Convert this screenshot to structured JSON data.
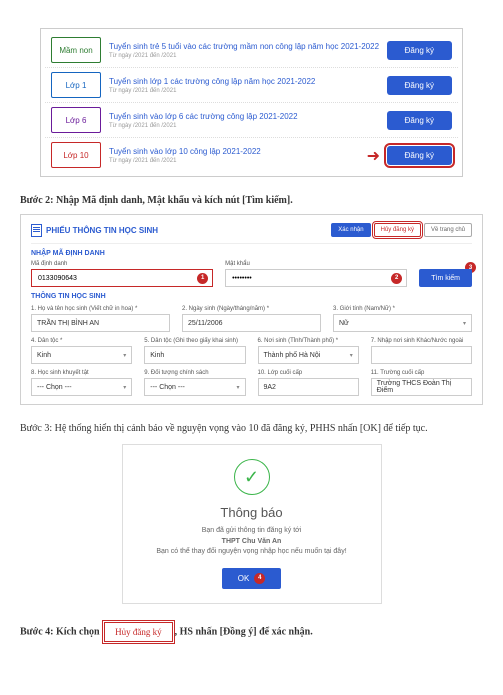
{
  "levels": [
    {
      "chip": "Mầm non",
      "title": "Tuyển sinh trẻ 5 tuổi vào các trường mầm non công lập năm học 2021-2022",
      "sub": "Từ ngày    /2021 đến    /2021",
      "btn": "Đăng ký"
    },
    {
      "chip": "Lớp 1",
      "title": "Tuyển sinh lớp 1 các trường công lập năm học 2021-2022",
      "sub": "Từ ngày    /2021 đến    /2021",
      "btn": "Đăng ký"
    },
    {
      "chip": "Lớp 6",
      "title": "Tuyển sinh vào lớp 6 các trường công lập 2021-2022",
      "sub": "Từ ngày    /2021 đến    /2021",
      "btn": "Đăng ký"
    },
    {
      "chip": "Lớp 10",
      "title": "Tuyển sinh vào lớp 10 công lập 2021-2022",
      "sub": "Từ ngày    /2021 đến    /2021",
      "btn": "Đăng ký"
    }
  ],
  "step2": "Bước 2: Nhập Mã định danh, Mật khẩu và kích nút [Tìm kiếm].",
  "form": {
    "title": "PHIẾU THÔNG TIN HỌC SINH",
    "btns": {
      "xn": "Xác nhận",
      "huy": "Hủy đăng ký",
      "ve": "Về trang chủ"
    },
    "sec1": "NHẬP MÃ ĐỊNH DANH",
    "f_id": "Mã định danh",
    "v_id": "0133090643",
    "f_pw": "Mật khẩu",
    "v_pw": "••••••••",
    "search": "Tìm kiếm",
    "sec2": "THÔNG TIN HỌC SINH",
    "f1": "1. Họ và tên học sinh (Viết chữ in hoa) *",
    "v1": "TRẦN THỊ BÌNH AN",
    "f2": "2. Ngày sinh (Ngày/tháng/năm) *",
    "v2": "25/11/2006",
    "f3": "3. Giới tính (Nam/Nữ) *",
    "v3": "Nữ",
    "f4": "4. Dân tộc *",
    "v4": "Kinh",
    "f5": "5. Dân tộc (Ghi theo giấy khai sinh)",
    "v5": "Kinh",
    "f6": "6. Nơi sinh (Tỉnh/Thành phố) *",
    "v6": "Thành phố Hà Nội",
    "f7": "7. Nhập nơi sinh Khác/Nước ngoài",
    "v7": "",
    "f8": "8. Học sinh khuyết tật",
    "v8": "--- Chọn ---",
    "f9": "9. Đối tượng chính sách",
    "v9": "--- Chọn ---",
    "f10": "10. Lớp cuối cấp",
    "v10": "9A2",
    "f11": "11. Trường cuối cấp",
    "v11": "Trường THCS Đoàn Thị Điểm"
  },
  "step3": "Bước 3: Hệ thống hiển thị cảnh báo về nguyện vọng vào 10 đã đăng ký, PHHS nhấn [OK] để tiếp tục.",
  "notif": {
    "title": "Thông báo",
    "l1": "Bạn đã gửi thông tin đăng ký tới",
    "l2": "THPT Chu Văn An",
    "l3": "Bạn có thể thay đổi nguyện vọng nhập học nếu muốn tại đây!",
    "ok": "OK"
  },
  "step4_a": "Bước 4: Kích chọn ",
  "step4_chip": "Hủy đăng ký",
  "step4_b": ", HS nhấn [Đồng ý] để xác nhận.",
  "badges": {
    "1": "1",
    "2": "2",
    "3": "3",
    "4": "4"
  }
}
